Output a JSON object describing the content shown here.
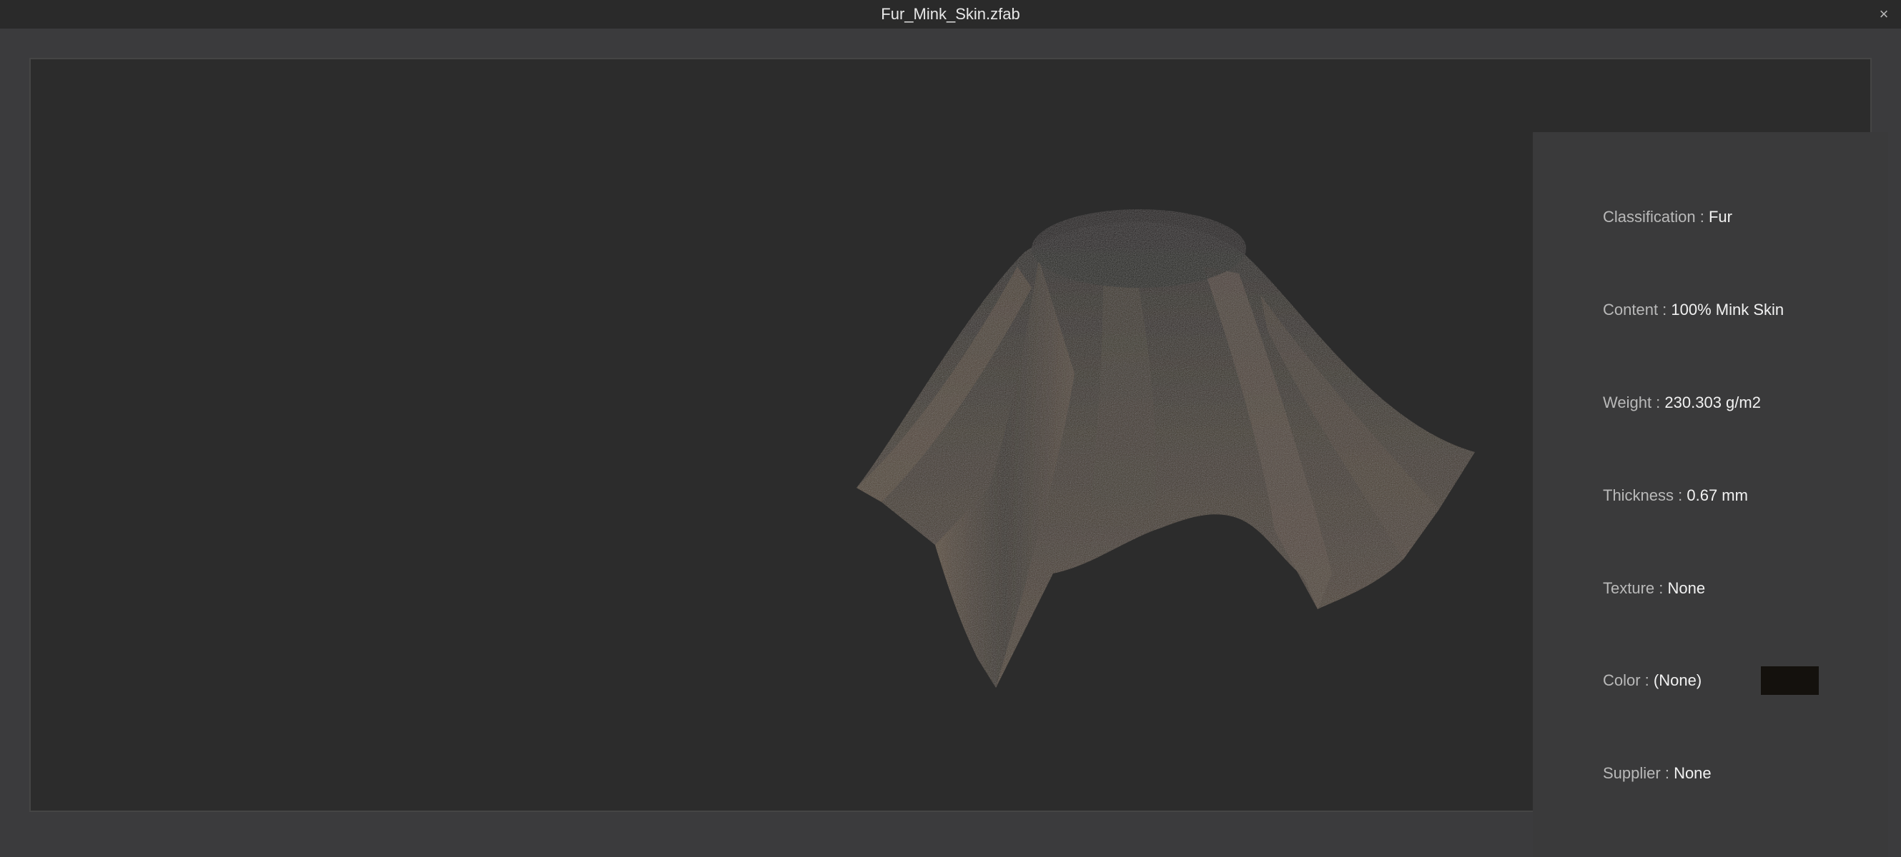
{
  "window": {
    "title": "Fur_Mink_Skin.zfab",
    "close_glyph": "×"
  },
  "info": {
    "classification_label": "Classification : ",
    "classification_value": "Fur",
    "content_label": "Content : ",
    "content_value": "100% Mink Skin",
    "weight_label": "Weight : ",
    "weight_value": "230.303 g/m2",
    "thickness_label": "Thickness : ",
    "thickness_value": "0.67 mm",
    "texture_label": "Texture : ",
    "texture_value": "None",
    "color_label": "Color : ",
    "color_value": "(None)",
    "color_swatch_hex": "#14110d",
    "supplier_label": "Supplier : ",
    "supplier_value": "None"
  }
}
